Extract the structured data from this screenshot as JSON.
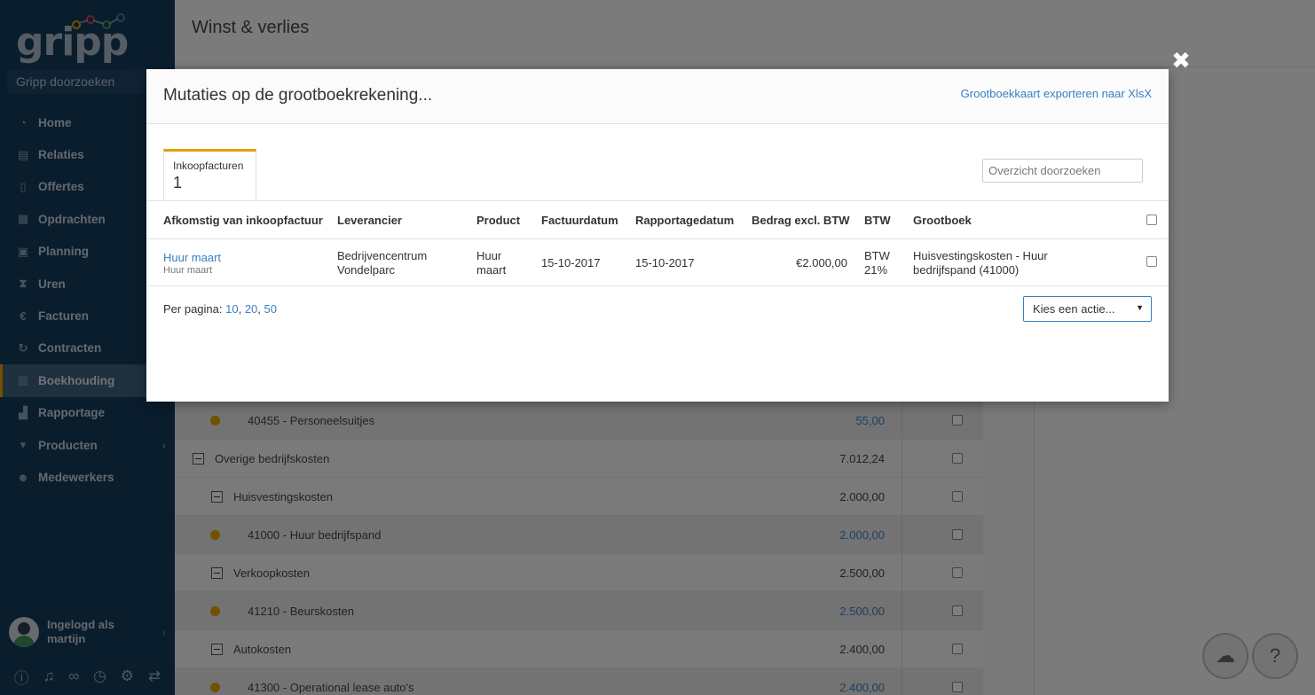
{
  "app": {
    "logo": "gripp",
    "search_placeholder": "Gripp doorzoeken",
    "page_title": "Winst & verlies"
  },
  "sidebar": {
    "items": [
      {
        "label": "Home",
        "icon": "dashboard-icon",
        "glyph": "◔"
      },
      {
        "label": "Relaties",
        "icon": "building-icon",
        "glyph": "▤"
      },
      {
        "label": "Offertes",
        "icon": "document-icon",
        "glyph": "▯"
      },
      {
        "label": "Opdrachten",
        "icon": "clipboard-icon",
        "glyph": "▦"
      },
      {
        "label": "Planning",
        "icon": "calendar-icon",
        "glyph": "▣"
      },
      {
        "label": "Uren",
        "icon": "hourglass-icon",
        "glyph": "⧗"
      },
      {
        "label": "Facturen",
        "icon": "euro-icon",
        "glyph": "€"
      },
      {
        "label": "Contracten",
        "icon": "refresh-icon",
        "glyph": "↻"
      },
      {
        "label": "Boekhouding",
        "icon": "ledger-icon",
        "glyph": "▥"
      },
      {
        "label": "Rapportage",
        "icon": "chart-icon",
        "glyph": "▟"
      },
      {
        "label": "Producten",
        "icon": "cart-icon",
        "glyph": "▾"
      },
      {
        "label": "Medewerkers",
        "icon": "users-icon",
        "glyph": "☻"
      }
    ],
    "user": {
      "line1": "Ingelogd als",
      "line2": "martijn"
    }
  },
  "background_table": {
    "rows": [
      {
        "label": "40455 - Personeelsuitjes",
        "amount": "55,00"
      },
      {
        "label": "Overige bedrijfskosten",
        "amount": "7.012,24"
      },
      {
        "label": "Huisvestingskosten",
        "amount": "2.000,00"
      },
      {
        "label": "41000 - Huur bedrijfspand",
        "amount": "2.000,00"
      },
      {
        "label": "Verkoopkosten",
        "amount": "2.500,00"
      },
      {
        "label": "41210 - Beurskosten",
        "amount": "2.500,00"
      },
      {
        "label": "Autokosten",
        "amount": "2.400,00"
      },
      {
        "label": "41300 - Operational lease auto's",
        "amount": "2.400,00"
      }
    ]
  },
  "modal": {
    "title": "Mutaties op de grootboekrekening...",
    "export_link": "Grootboekkaart exporteren naar XlsX",
    "tab": {
      "label": "Inkoopfacturen",
      "count": "1"
    },
    "search_placeholder": "Overzicht doorzoeken",
    "columns": [
      "Afkomstig van inkoopfactuur",
      "Leverancier",
      "Product",
      "Factuurdatum",
      "Rapportagedatum",
      "Bedrag excl. BTW",
      "BTW",
      "Grootboek"
    ],
    "row": {
      "invoice": "Huur maart",
      "invoice_sub": "Huur maart",
      "supplier_1": "Bedrijvencentrum",
      "supplier_2": "Vondelparc",
      "product_1": "Huur",
      "product_2": "maart",
      "invoice_date": "15-10-2017",
      "report_date": "15-10-2017",
      "amount": "€2.000,00",
      "vat_1": "BTW",
      "vat_2": "21%",
      "ledger_1": "Huisvestingskosten - Huur",
      "ledger_2": "bedrijfspand (41000)"
    },
    "pager_label": "Per pagina:",
    "pager_options": [
      "10",
      "20",
      "50"
    ],
    "action_select": "Kies een actie..."
  }
}
